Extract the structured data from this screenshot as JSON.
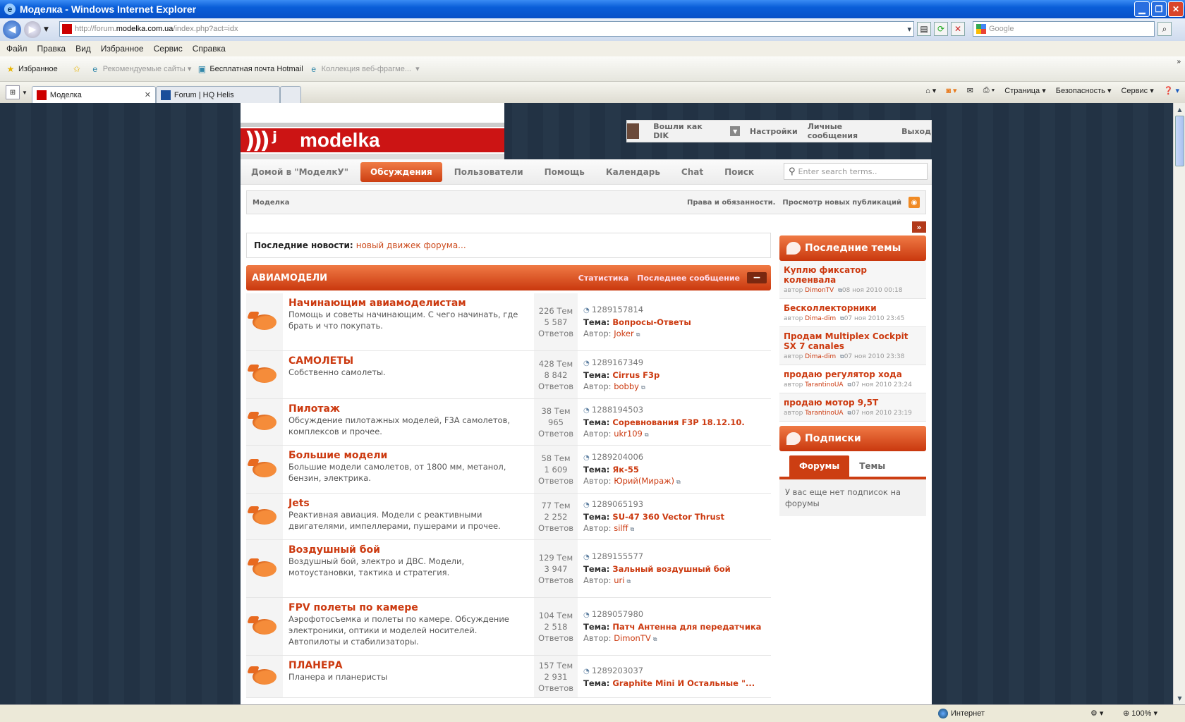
{
  "window": {
    "title": "Моделка - Windows Internet Explorer"
  },
  "address": {
    "url_prefix": "http://forum.",
    "url_domain": "modelka.com.ua",
    "url_path": "/index.php?act=idx",
    "search_placeholder": "Google"
  },
  "menu": [
    "Файл",
    "Правка",
    "Вид",
    "Избранное",
    "Сервис",
    "Справка"
  ],
  "favorites_bar": {
    "favorites": "Избранное",
    "recommended": "Рекомендуемые сайты",
    "hotmail": "Бесплатная почта Hotmail",
    "gallery": "Коллекция веб-фрагме..."
  },
  "tabs": [
    {
      "label": "Моделка"
    },
    {
      "label": "Forum | HQ Helis"
    }
  ],
  "command_bar": {
    "page": "Страница",
    "safety": "Безопасность",
    "tools": "Сервис"
  },
  "status": {
    "zone": "Интернет",
    "zoom": "100%"
  },
  "site": {
    "logo": "modelka",
    "user": {
      "logged_in_as": "Вошли как DIK",
      "settings": "Настройки",
      "messages": "Личные сообщения",
      "logout": "Выход"
    },
    "nav": [
      "Домой в \"МоделкУ\"",
      "Обсуждения",
      "Пользователи",
      "Помощь",
      "Календарь",
      "Chat",
      "Поиск"
    ],
    "search_placeholder": "Enter search terms..",
    "breadcrumb": "Моделка",
    "crumb_links": {
      "rights": "Права и обязанности.",
      "new_posts": "Просмотр новых публикаций"
    },
    "news": {
      "label": "Последние новости:",
      "text": "новый движек форума..."
    },
    "category": {
      "title": "АВИАМОДЕЛИ",
      "col_stats": "Статистика",
      "col_last": "Последнее сообщение"
    },
    "forums": [
      {
        "name": "Начинающим авиамоделистам",
        "desc": "Помощь и советы начинающим. С чего начинать, где брать и что покупать.",
        "topics": "226",
        "topics_label": "Тем",
        "replies": "5 587",
        "replies_label": "Ответов",
        "last_id": "1289157814",
        "last_topic": "Вопросы-Ответы",
        "last_author": "Joker"
      },
      {
        "name": "САМОЛЕТЫ",
        "desc": "Собственно самолеты.",
        "topics": "428",
        "topics_label": "Тем",
        "replies": "8 842",
        "replies_label": "Ответов",
        "last_id": "1289167349",
        "last_topic": "Cirrus F3p",
        "last_author": "bobby"
      },
      {
        "name": "Пилотаж",
        "desc": "Обсуждение пилотажных моделей, F3A самолетов, комплексов и прочее.",
        "topics": "38",
        "topics_label": "Тем",
        "replies": "965",
        "replies_label": "Ответов",
        "last_id": "1288194503",
        "last_topic": "Соревнования F3P 18.12.10.",
        "last_author": "ukr109"
      },
      {
        "name": "Большие модели",
        "desc": "Большие модели самолетов, от 1800 мм, метанол, бензин, электрика.",
        "topics": "58",
        "topics_label": "Тем",
        "replies": "1 609",
        "replies_label": "Ответов",
        "last_id": "1289204006",
        "last_topic": "Як-55",
        "last_author": "Юрий(Мираж)"
      },
      {
        "name": "Jets",
        "desc": "Реактивная авиация. Модели с реактивными двигателями, импеллерами, пушерами и прочее.",
        "topics": "77",
        "topics_label": "Тем",
        "replies": "2 252",
        "replies_label": "Ответов",
        "last_id": "1289065193",
        "last_topic": "SU-47 360 Vector Thrust",
        "last_author": "silff"
      },
      {
        "name": "Воздушный бой",
        "desc": "Воздушный бой, электро и ДВС. Модели, мотоустановки, тактика и стратегия.",
        "topics": "129",
        "topics_label": "Тем",
        "replies": "3 947",
        "replies_label": "Ответов",
        "last_id": "1289155577",
        "last_topic": "Зальный воздушный бой",
        "last_author": "uri"
      },
      {
        "name": "FPV полеты по камере",
        "desc": "Аэрофотосъемка и полеты по камере. Обсуждение электроники, оптики и моделей носителей. Автопилоты и стабилизаторы.",
        "topics": "104",
        "topics_label": "Тем",
        "replies": "2 518",
        "replies_label": "Ответов",
        "last_id": "1289057980",
        "last_topic": "Патч Антенна для передатчика",
        "last_author": "DimonTV"
      },
      {
        "name": "ПЛАНЕРА",
        "desc": "Планера и планеристы",
        "topics": "157",
        "topics_label": "Тем",
        "replies": "2 931",
        "replies_label": "Ответов",
        "last_id": "1289203037",
        "last_topic": "Graphite Mini И Остальные \"...",
        "last_author": ""
      }
    ],
    "labels": {
      "topic": "Тема:",
      "author": "Автор:",
      "by": "автор"
    },
    "latest_topics": {
      "title": "Последние темы",
      "items": [
        {
          "title": "Куплю фиксатор коленвала",
          "author": "DimonTV",
          "date": "08 ноя 2010 00:18"
        },
        {
          "title": "Бесколлекторники",
          "author": "Dima-dim",
          "date": "07 ноя 2010 23:45"
        },
        {
          "title": "Продам Multiplex Cockpit SX 7 canales",
          "author": "Dima-dim",
          "date": "07 ноя 2010 23:38"
        },
        {
          "title": "продаю регулятор хода",
          "author": "TarantinoUA",
          "date": "07 ноя 2010 23:24"
        },
        {
          "title": "продаю мотор 9,5T",
          "author": "TarantinoUA",
          "date": "07 ноя 2010 23:19"
        }
      ]
    },
    "subscriptions": {
      "title": "Подписки",
      "tab_forums": "Форумы",
      "tab_topics": "Темы",
      "empty": "У вас еще нет подписок на форумы"
    }
  },
  "colors": {
    "accent": "#cc3e12",
    "link": "#cc3a10",
    "brand_red": "#cc1414"
  }
}
